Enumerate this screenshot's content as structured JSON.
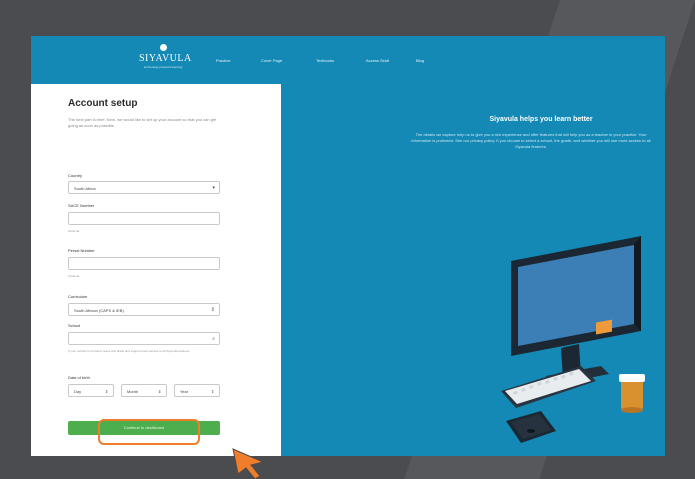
{
  "nav": {
    "logo": "SIYAVULA",
    "logo_sub": "technology-powered learning",
    "items": [
      "Practice",
      "Cover Page",
      "Textbooks",
      "Access Siddt",
      "Blog"
    ]
  },
  "form": {
    "title": "Account setup",
    "intro": "The next part is brief. Next, we would like to set up your account so that you can get going as soon as possible.",
    "country_label": "Country",
    "country_value": "South Africa",
    "sacc_label": "SACE Number",
    "sacc_note": "Optional",
    "persal_label": "Persal Number",
    "persal_note": "Optional",
    "curriculum_label": "Curriculum",
    "curriculum_value": "South African (CAPS & IEB)",
    "school_label": "School",
    "school_help": "If your school is not listed, leave this blank and support team access to all Siyavula features",
    "dob_label": "Date of birth",
    "dob_day": "Day",
    "dob_month": "Month",
    "dob_year": "Year",
    "submit_label": "Continue to dashboard"
  },
  "promo": {
    "title": "Siyavula helps you learn better",
    "text": "The details we capture help us to give you a rich experience and offer features that will help you as a teacher in your practice. Your information is protected. See our privacy policy. If you choose to select a school, the grade, and whether you will use more access to all Siyavula features."
  },
  "colors": {
    "brand": "#1489b5",
    "submit": "#4cae4c",
    "highlight": "#ef7d2a"
  }
}
